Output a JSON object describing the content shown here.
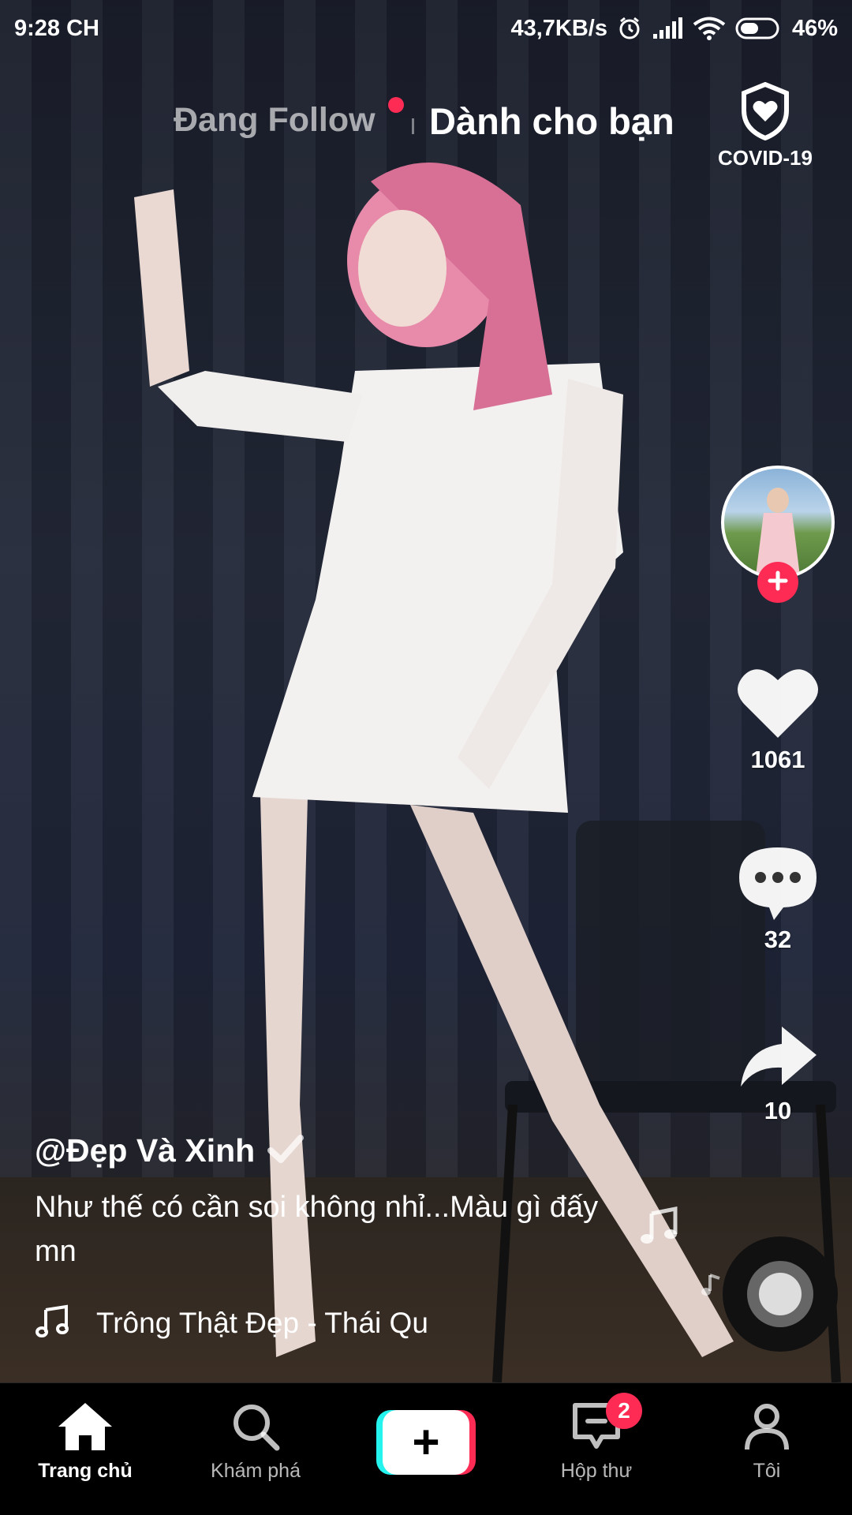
{
  "status_bar": {
    "time": "9:28 CH",
    "network_speed": "43,7KB/s",
    "battery": "46%",
    "icons": [
      "alarm-icon",
      "signal-icon",
      "wifi-icon",
      "battery-icon"
    ]
  },
  "top_tabs": {
    "following": "Đang Follow",
    "for_you": "Dành cho bạn",
    "active": "for_you"
  },
  "covid": {
    "label": "COVID-19",
    "icon": "shield-heart-icon"
  },
  "actions": {
    "likes": "1061",
    "comments": "32",
    "shares": "10"
  },
  "post": {
    "username": "@Đẹp Và Xinh",
    "verified_icon": "checkmark-icon",
    "description": "Như thế có cần soi không nhỉ...Màu gì đấy mn",
    "music": "Trông Thật Đẹp - Thái Qu"
  },
  "bottom_nav": {
    "items": [
      {
        "label": "Trang chủ",
        "icon": "home-icon",
        "active": true
      },
      {
        "label": "Khám phá",
        "icon": "search-icon",
        "active": false
      },
      {
        "label": "",
        "icon": "plus-icon",
        "active": false
      },
      {
        "label": "Hộp thư",
        "icon": "inbox-icon",
        "active": false,
        "badge": "2"
      },
      {
        "label": "Tôi",
        "icon": "profile-icon",
        "active": false
      }
    ]
  },
  "colors": {
    "accent": "#fe2c55",
    "cyan": "#25f4ee",
    "background": "#1b1f2c"
  }
}
